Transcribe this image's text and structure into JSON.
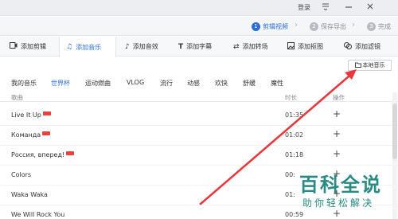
{
  "titlebar": {
    "login": "登录",
    "icons": [
      "dropdown-lines-icon",
      "minimize-icon",
      "close-icon"
    ]
  },
  "steps": [
    {
      "num": "1",
      "label": "剪辑视频",
      "active": true
    },
    {
      "num": "2",
      "label": "保存导出",
      "active": false
    },
    {
      "num": "3",
      "label": "完成",
      "active": false
    }
  ],
  "tooltabs": [
    {
      "label": "添加剪辑",
      "icon": "film-icon",
      "active": false
    },
    {
      "label": "添加音乐",
      "icon": "music-note-icon",
      "active": true
    },
    {
      "label": "添加音效",
      "icon": "sound-effect-icon",
      "active": false
    },
    {
      "label": "添加字幕",
      "icon": "subtitle-icon",
      "active": false
    },
    {
      "label": "添加转场",
      "icon": "transition-icon",
      "active": false
    },
    {
      "label": "添加抠图",
      "icon": "cutout-icon",
      "active": false
    },
    {
      "label": "添加滤镜",
      "icon": "filter-icon",
      "active": false
    }
  ],
  "local_music": {
    "label": "本地音乐",
    "icon": "folder-icon"
  },
  "categories": [
    {
      "label": "我的音乐",
      "active": false
    },
    {
      "label": "世界杯",
      "active": true
    },
    {
      "label": "运动燃曲",
      "active": false
    },
    {
      "label": "VLOG",
      "active": false
    },
    {
      "label": "流行",
      "active": false
    },
    {
      "label": "动感",
      "active": false
    },
    {
      "label": "欢快",
      "active": false
    },
    {
      "label": "舒缓",
      "active": false
    },
    {
      "label": "魔性",
      "active": false
    }
  ],
  "table": {
    "headers": {
      "name": "歌曲",
      "duration": "时长",
      "action": "操作"
    },
    "rows": [
      {
        "name": "Live It Up",
        "badge": true,
        "duration": "01:35"
      },
      {
        "name": "Команда",
        "badge": true,
        "duration": "01:02"
      },
      {
        "name": "Россия, вперед!",
        "badge": true,
        "duration": "01:18"
      },
      {
        "name": "Colors",
        "badge": false,
        "duration": "00:"
      },
      {
        "name": "Waka Waka",
        "badge": false,
        "duration": "01:"
      },
      {
        "name": "We Will Rock You",
        "badge": false,
        "duration": "00:59"
      }
    ],
    "add_symbol": "+"
  },
  "watermark": {
    "title": "百科全说",
    "subtitle": "助你轻松解决"
  },
  "colors": {
    "accent": "#2b6fd6",
    "arrow": "#e8383d",
    "watermark": "#2a8b84"
  }
}
